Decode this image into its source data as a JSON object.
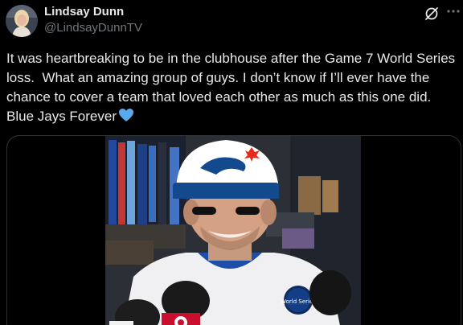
{
  "author": {
    "display_name": "Lindsay Dunn",
    "handle": "@LindsayDunnTV"
  },
  "tweet": {
    "text": "It was heartbreaking to be in the clubhouse after the Game 7 World Series loss.  What an amazing group of guys. I don’t know if I’ll ever have the chance to cover a team that loved each other as much as this one did. Blue Jays Forever",
    "emoji": "blue-heart-icon"
  },
  "icons": {
    "header_action": "grok-slash-icon",
    "more": "more-icon"
  },
  "colors": {
    "background": "#000000",
    "text": "#e7e9ea",
    "secondary_text": "#71767b",
    "heart": "#5aa9ee",
    "jays_blue": "#134a8e"
  },
  "media": {
    "type": "video",
    "patch_text": "World Series"
  }
}
